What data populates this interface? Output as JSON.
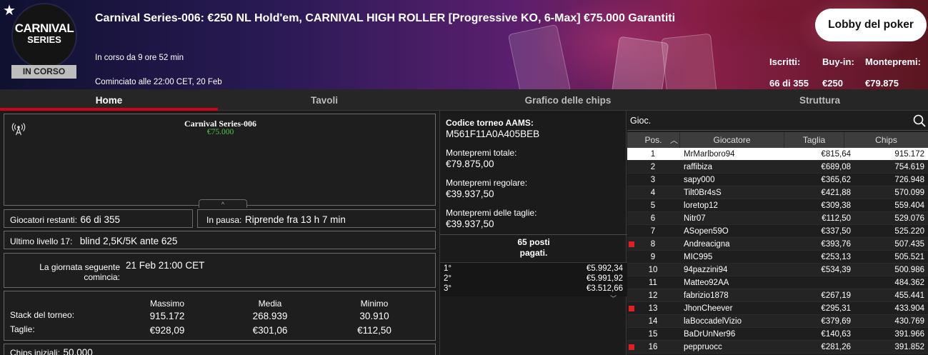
{
  "header": {
    "logo_line1": "CARNIVAL",
    "logo_line2": "SERIES",
    "status": "IN CORSO",
    "title": "Carnival Series-006: €250 NL Hold'em, CARNIVAL HIGH ROLLER [Progressive KO, 6-Max] €75.000 Garantiti",
    "running_time": "In corso da 9 ore 52 min",
    "started_at": "Cominciato alle 22:00 CET, 20 Feb",
    "lobby_button": "Lobby del poker",
    "stats": [
      {
        "label": "Iscritti:",
        "value": "66 di 355"
      },
      {
        "label": "Buy-in:",
        "value": "€250"
      },
      {
        "label": "Montepremi:",
        "value": "€79.875"
      }
    ]
  },
  "tabs": [
    "Home",
    "Tavoli",
    "Grafico delle chips",
    "Struttura"
  ],
  "info_card": {
    "title": "Carnival Series-006",
    "prize": "€75.000",
    "collapse_glyph": "^"
  },
  "details": {
    "players_label": "Giocatori restanti:",
    "players_value": "66 di 355",
    "pause_label": "In pausa:",
    "pause_value": "Riprende fra 13 h 7 min",
    "level_label": "Ultimo livello 17:",
    "level_value": "blind 2,5K/5K ante 625",
    "nextday_label_1": "La giornata seguente",
    "nextday_label_2": "comincia:",
    "nextday_value": "21 Feb 21:00 CET",
    "stack_headers": [
      "Massimo",
      "Media",
      "Minimo"
    ],
    "stack_label": "Stack del torneo:",
    "bounty_label": "Taglie:",
    "stack_values": [
      "915.172",
      "268.939",
      "30.910"
    ],
    "bounty_values": [
      "€928,09",
      "€301,06",
      "€112,50"
    ],
    "chips_label": "Chips iniziali:",
    "chips_value": "50.000"
  },
  "middle": {
    "aams_label": "Codice torneo AAMS:",
    "aams_value": "M561F11A0A405BEB",
    "total_label": "Montepremi totale:",
    "total_value": "€79.875,00",
    "regular_label": "Montepremi regolare:",
    "regular_value": "€39.937,50",
    "bounty_label": "Montepremi delle taglie:",
    "bounty_value": "€39.937,50",
    "paid_line1": "65 posti",
    "paid_line2": "pagati.",
    "payouts": [
      {
        "pos": "1°",
        "amount": "€5.992,34"
      },
      {
        "pos": "2°",
        "amount": "€5.991,92"
      },
      {
        "pos": "3°",
        "amount": "€3.512,66"
      }
    ]
  },
  "leaderboard": {
    "search_placeholder": "Gioc.",
    "headers": [
      "Pos.",
      "Giocatore",
      "Taglia",
      "Chips"
    ],
    "rows": [
      {
        "pos": "1",
        "name": "MrMarlboro94",
        "bounty": "€815,64",
        "chips": "915.172",
        "selected": true,
        "flag": false
      },
      {
        "pos": "2",
        "name": "raffibiza",
        "bounty": "€689,08",
        "chips": "754.619",
        "selected": false,
        "flag": false
      },
      {
        "pos": "3",
        "name": "sapy000",
        "bounty": "€365,62",
        "chips": "726.948",
        "selected": false,
        "flag": false
      },
      {
        "pos": "4",
        "name": "Tilt0Br4sS",
        "bounty": "€421,88",
        "chips": "570.099",
        "selected": false,
        "flag": false
      },
      {
        "pos": "5",
        "name": "loretop12",
        "bounty": "€309,38",
        "chips": "559.404",
        "selected": false,
        "flag": false
      },
      {
        "pos": "6",
        "name": "Nitr07",
        "bounty": "€112,50",
        "chips": "529.076",
        "selected": false,
        "flag": false
      },
      {
        "pos": "7",
        "name": "ASopen59O",
        "bounty": "€337,50",
        "chips": "525.220",
        "selected": false,
        "flag": false
      },
      {
        "pos": "8",
        "name": "Andreacigna",
        "bounty": "€393,76",
        "chips": "507.435",
        "selected": false,
        "flag": true
      },
      {
        "pos": "9",
        "name": "MIC995",
        "bounty": "€253,13",
        "chips": "505.521",
        "selected": false,
        "flag": false
      },
      {
        "pos": "10",
        "name": "94pazzini94",
        "bounty": "€534,39",
        "chips": "500.986",
        "selected": false,
        "flag": false
      },
      {
        "pos": "11",
        "name": "Matteo92AA",
        "bounty": "",
        "chips": "484.362",
        "selected": false,
        "flag": false
      },
      {
        "pos": "12",
        "name": "fabrizio1878",
        "bounty": "€267,19",
        "chips": "455.441",
        "selected": false,
        "flag": false
      },
      {
        "pos": "13",
        "name": "JhonCheever",
        "bounty": "€295,31",
        "chips": "433.904",
        "selected": false,
        "flag": true
      },
      {
        "pos": "14",
        "name": "laBoccadelVizio",
        "bounty": "€379,69",
        "chips": "430.769",
        "selected": false,
        "flag": false
      },
      {
        "pos": "15",
        "name": "BaDrUnNer96",
        "bounty": "€140,63",
        "chips": "391.966",
        "selected": false,
        "flag": false
      },
      {
        "pos": "16",
        "name": "peppruocc",
        "bounty": "€281,26",
        "chips": "391.852",
        "selected": false,
        "flag": true
      }
    ]
  },
  "colors": {
    "accent_red": "#d0021b",
    "prize_green": "#4fc04f",
    "flag_red": "#e02020"
  }
}
